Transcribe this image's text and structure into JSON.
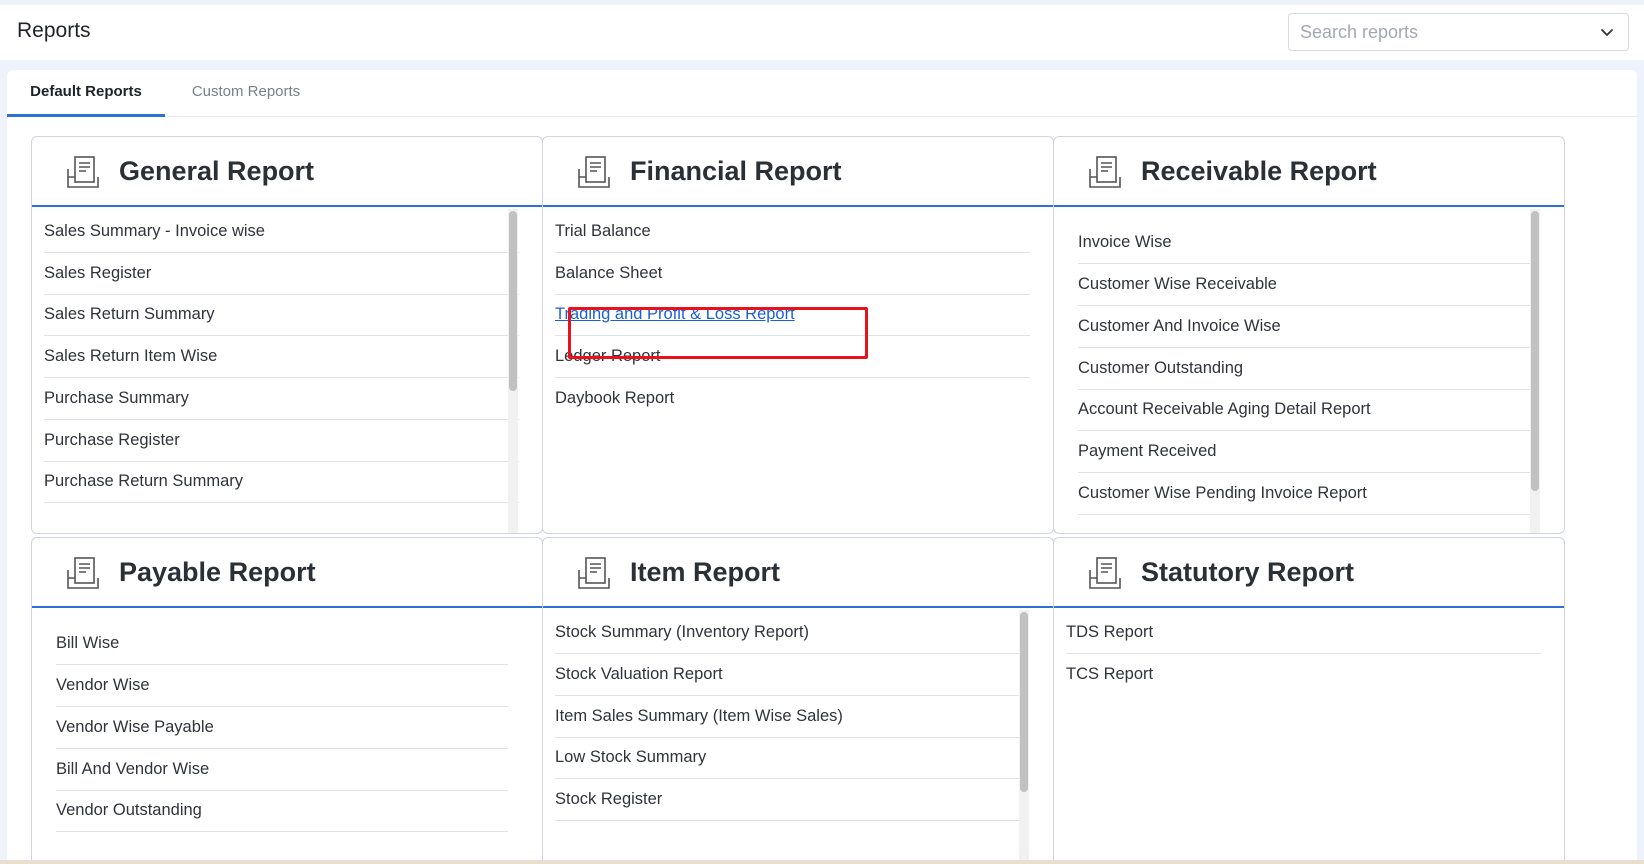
{
  "header": {
    "title": "Reports",
    "search_placeholder": "Search reports"
  },
  "tabs": [
    {
      "label": "Default Reports",
      "active": true
    },
    {
      "label": "Custom Reports",
      "active": false
    }
  ],
  "cards": {
    "general": {
      "title": "General Report",
      "items": [
        "Sales Summary - Invoice wise",
        "Sales Register",
        "Sales Return Summary",
        "Sales Return Item Wise",
        "Purchase Summary",
        "Purchase Register",
        "Purchase Return Summary"
      ]
    },
    "financial": {
      "title": "Financial Report",
      "items": [
        "Trial Balance",
        "Balance Sheet",
        "Trading and Profit & Loss Report",
        "Ledger Report",
        "Daybook Report"
      ]
    },
    "receivable": {
      "title": "Receivable Report",
      "items": [
        "Invoice Wise",
        "Customer Wise Receivable",
        "Customer And Invoice Wise",
        "Customer Outstanding",
        "Account Receivable Aging Detail Report",
        "Payment Received",
        "Customer Wise Pending Invoice Report"
      ]
    },
    "payable": {
      "title": "Payable Report",
      "items": [
        "Bill Wise",
        "Vendor Wise",
        "Vendor Wise Payable",
        "Bill And Vendor Wise",
        "Vendor Outstanding"
      ]
    },
    "item": {
      "title": "Item Report",
      "items": [
        "Stock Summary (Inventory Report)",
        "Stock Valuation Report",
        "Item Sales Summary (Item Wise Sales)",
        "Low Stock Summary",
        "Stock Register"
      ]
    },
    "statutory": {
      "title": "Statutory Report",
      "items": [
        "TDS Report",
        "TCS Report"
      ]
    }
  },
  "colors": {
    "accent": "#2f6fd8",
    "link": "#1a5fd6",
    "highlight": "#e8111c"
  },
  "icons": {
    "card": "report-document-icon",
    "dropdown": "chevron-down-icon"
  }
}
